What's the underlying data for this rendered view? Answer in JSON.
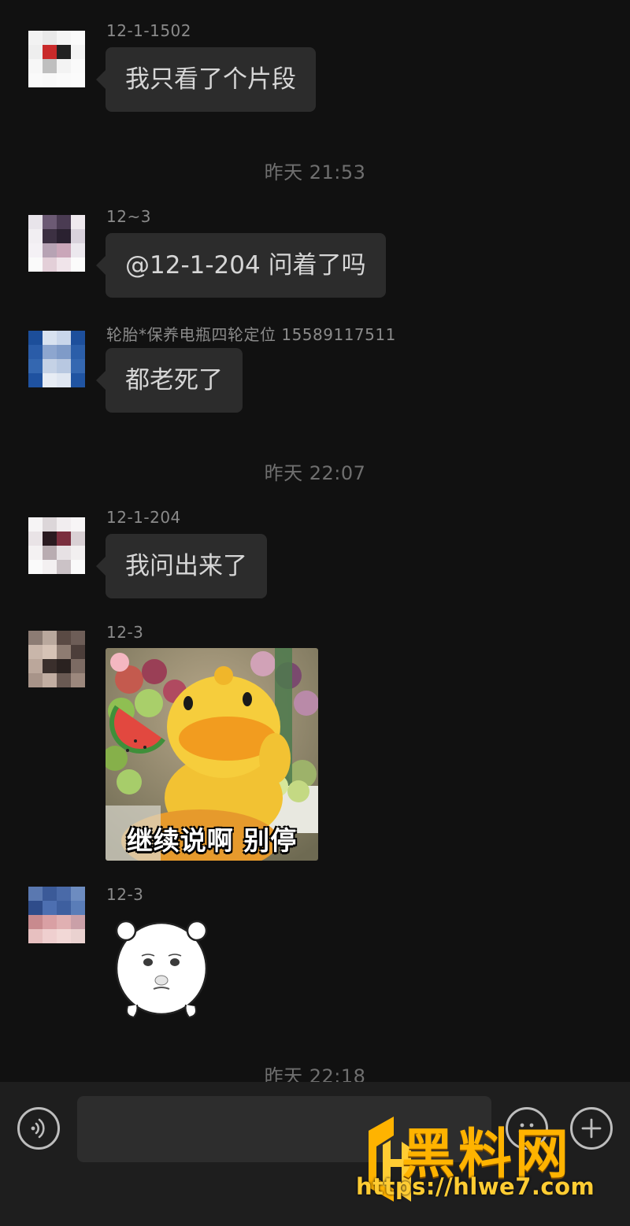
{
  "messages": [
    {
      "sender": "12-1-1502",
      "text": "我只看了个片段"
    },
    {
      "sender": "12~3",
      "text": "@12-1-204 问着了吗"
    },
    {
      "sender": "轮胎*保养电瓶四轮定位 15589117511",
      "text": "都老死了"
    },
    {
      "sender": "12-1-204",
      "text": "我问出来了"
    },
    {
      "sender": "12-3",
      "sticker_caption": "继续说啊  别停"
    },
    {
      "sender": "12-3"
    }
  ],
  "timestamps": [
    "昨天 21:53",
    "昨天 22:07",
    "昨天 22:18"
  ],
  "input_bar": {
    "voice_icon": "voice-icon",
    "emoji_icon": "emoji-icon",
    "plus_icon": "plus-icon"
  },
  "watermark": {
    "brand": "黑料网",
    "url": "https://hlwe7.com",
    "color": "#ffb300"
  },
  "colors": {
    "background": "#111111",
    "bubble": "#2c2c2c",
    "bubble_text": "#d6d6d6",
    "sender_text": "#8a8a8a",
    "timestamp_text": "#6f6f6f"
  }
}
